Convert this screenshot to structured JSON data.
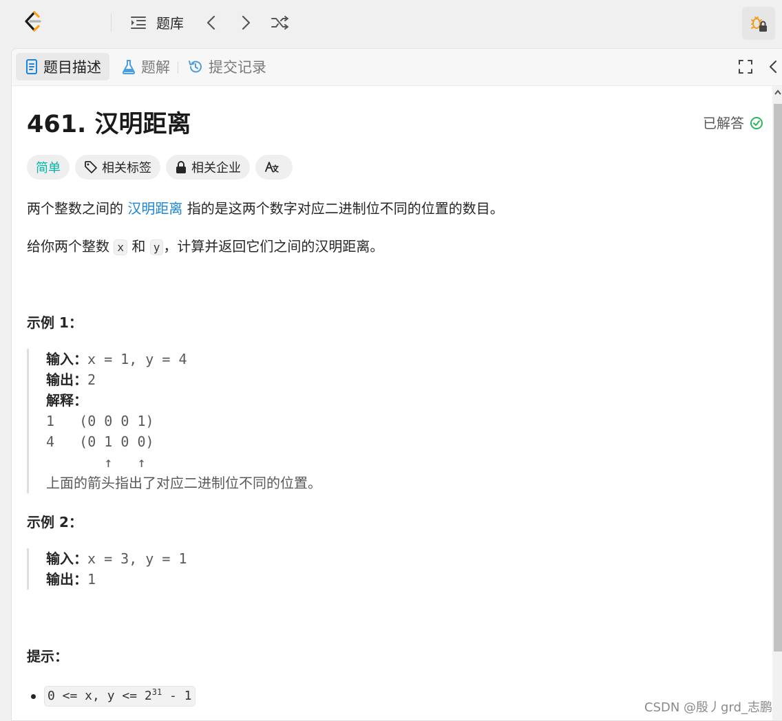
{
  "topbar": {
    "problem_list_label": "题库"
  },
  "tabs": {
    "description": "题目描述",
    "solutions": "题解",
    "submissions": "提交记录"
  },
  "problem": {
    "title": "461. 汉明距离",
    "status": "已解答",
    "difficulty": "简单",
    "chips": {
      "tags": "相关标签",
      "companies": "相关企业"
    },
    "desc1": {
      "pre": "两个整数之间的 ",
      "link": "汉明距离",
      "post": " 指的是这两个数字对应二进制位不同的位置的数目。"
    },
    "desc2": {
      "pre": "给你两个整数 ",
      "x": "x",
      "mid": " 和 ",
      "y": "y",
      "post": "，计算并返回它们之间的汉明距离。"
    }
  },
  "examples": [
    {
      "heading": "示例 1：",
      "input_label": "输入：",
      "input_value": "x = 1, y = 4",
      "output_label": "输出：",
      "output_value": "2",
      "explain_label": "解释：",
      "explain_lines": [
        "1   (0 0 0 1)",
        "4   (0 1 0 0)",
        "       ↑   ↑"
      ],
      "explain_text": "上面的箭头指出了对应二进制位不同的位置。"
    },
    {
      "heading": "示例 2：",
      "input_label": "输入：",
      "input_value": "x = 3, y = 1",
      "output_label": "输出：",
      "output_value": "1"
    }
  ],
  "hints": {
    "heading": "提示：",
    "constraint_pre": "0 <= x, y <= 2",
    "constraint_exp": "31",
    "constraint_post": " - 1"
  },
  "watermark": "CSDN @殷丿grd_志鹏",
  "colors": {
    "easy": "#00b8a3",
    "link": "#1a86d9",
    "solved_check": "#2db55d"
  }
}
